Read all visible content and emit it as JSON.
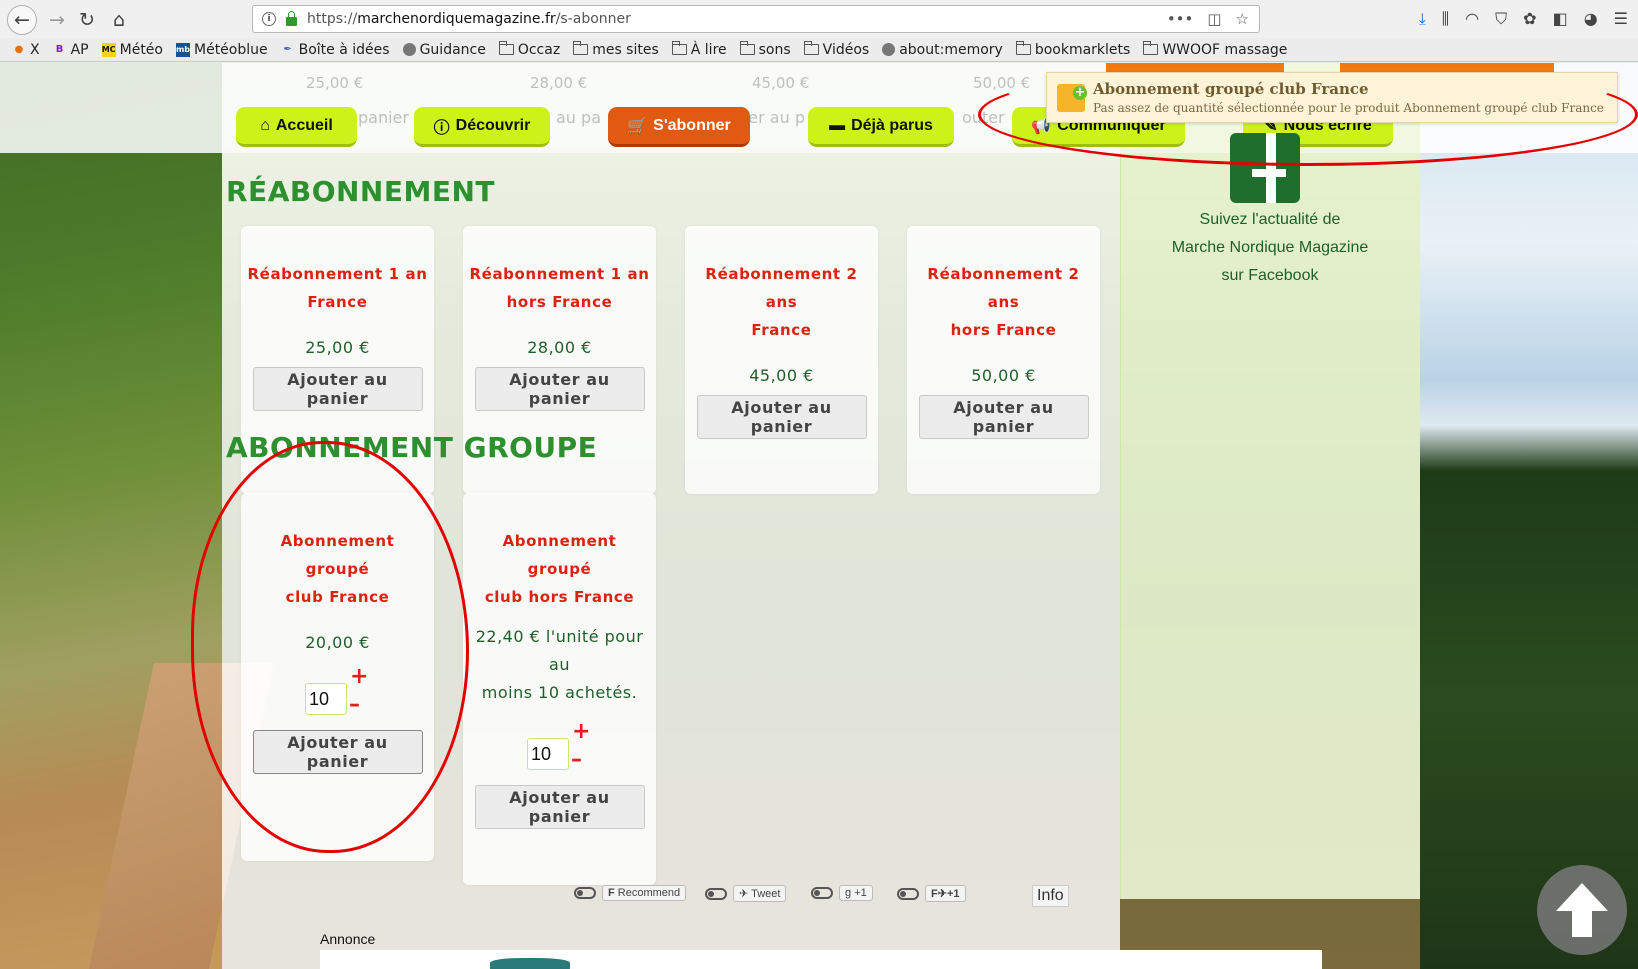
{
  "browser": {
    "url_scheme": "https://",
    "url_domain": "marchenordiquemagazine.fr",
    "url_path": "/s-abonner",
    "url_more": "•••",
    "bookmarks": [
      {
        "label": "X",
        "icon": "firefox-icon"
      },
      {
        "label": "AP",
        "icon": "b-icon"
      },
      {
        "label": "Météo",
        "icon": "mc-icon"
      },
      {
        "label": "Météoblue",
        "icon": "mb-icon"
      },
      {
        "label": "Boîte à idées",
        "icon": "pen-icon"
      },
      {
        "label": "Guidance",
        "icon": "globe-icon"
      },
      {
        "label": "Occaz",
        "icon": "folder-icon"
      },
      {
        "label": "mes sites",
        "icon": "folder-icon"
      },
      {
        "label": "À lire",
        "icon": "folder-icon"
      },
      {
        "label": "sons",
        "icon": "folder-icon"
      },
      {
        "label": "Vidéos",
        "icon": "folder-icon"
      },
      {
        "label": "about:memory",
        "icon": "globe-icon"
      },
      {
        "label": "bookmarklets",
        "icon": "folder-icon"
      },
      {
        "label": "WWOOF massage",
        "icon": "folder-icon"
      }
    ]
  },
  "faded_prices": [
    "25,00 €",
    "28,00 €",
    "45,00 €",
    "50,00 €"
  ],
  "faded_buttons": [
    "panier",
    "au pa",
    "ter au p",
    "outer"
  ],
  "nav": {
    "home": "Accueil",
    "discover": "Découvrir",
    "subscribe": "S'abonner",
    "archive": "Déjà parus",
    "communicate": "Communiquer",
    "write": "Nous écrire"
  },
  "notification": {
    "title": "Abonnement groupé club France",
    "message": "Pas assez de quantité sélectionnée pour le produit Abonnement groupé club France"
  },
  "sections": {
    "renewal": "Réabonnement",
    "group": "Abonnement groupe"
  },
  "renewal_products": [
    {
      "title_line1": "Réabonnement 1 an",
      "title_line2": "France",
      "price": "25,00 €",
      "button": "Ajouter au panier"
    },
    {
      "title_line1": "Réabonnement 1 an",
      "title_line2": "hors France",
      "price": "28,00 €",
      "button": "Ajouter au panier"
    },
    {
      "title_line1": "Réabonnement 2 ans",
      "title_line2": "France",
      "price": "45,00 €",
      "button": "Ajouter au panier"
    },
    {
      "title_line1": "Réabonnement 2 ans",
      "title_line2": "hors France",
      "price": "50,00 €",
      "button": "Ajouter au panier"
    }
  ],
  "group_products": [
    {
      "title_line1": "Abonnement groupé",
      "title_line2": "club France",
      "price": "20,00 €",
      "qty": "10",
      "plus": "+",
      "minus": "–",
      "button": "Ajouter au panier"
    },
    {
      "title_line1": "Abonnement groupé",
      "title_line2": "club hors France",
      "price_line1": "22,40 € l'unité pour au",
      "price_line2": "moins 10 achetés.",
      "qty": "10",
      "plus": "+",
      "minus": "–",
      "button": "Ajouter au panier"
    }
  ],
  "sidebar": {
    "line1": "Suivez l'actualité de",
    "line2": "Marche Nordique Magazine",
    "line3": "sur Facebook"
  },
  "social": {
    "recommend": "Recommend",
    "tweet": "Tweet",
    "gplus": "+1",
    "fshare": "+1",
    "info": "Info"
  },
  "annonce": "Annonce"
}
